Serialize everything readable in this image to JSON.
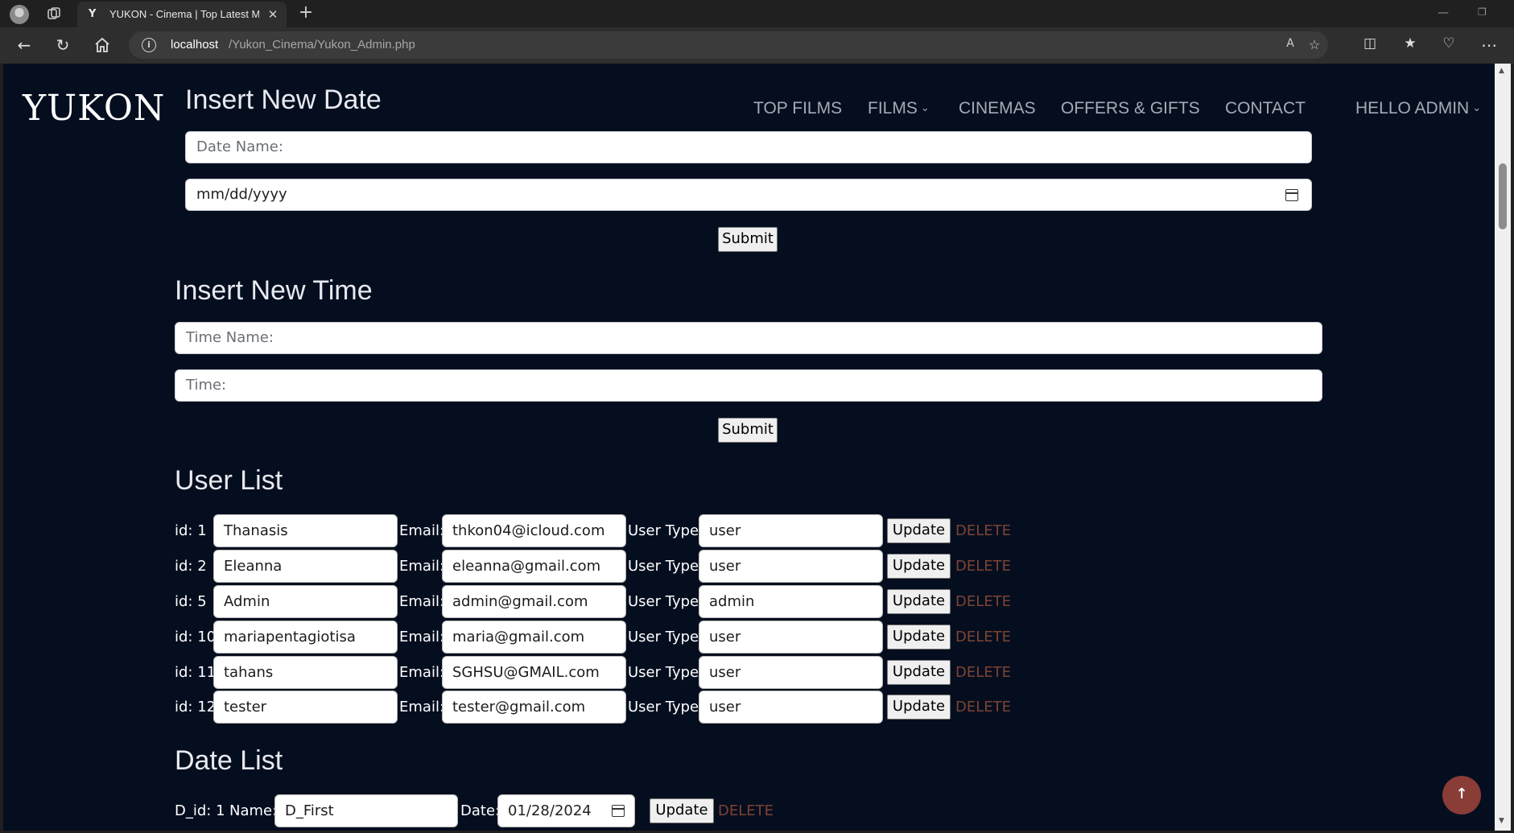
{
  "browser": {
    "tab_title": "YUKON - Cinema | Top Latest Movies",
    "tab_favicon": "Y",
    "url_host": "localhost",
    "url_path": "/Yukon_Cinema/Yukon_Admin.php"
  },
  "site": {
    "logo": "YUKON",
    "nav": {
      "top_films": "TOP FILMS",
      "films": "FILMS",
      "cinemas": "CINEMAS",
      "offers": "OFFERS & GIFTS",
      "contact": "CONTACT",
      "account": "HELLO ADMIN"
    }
  },
  "insert_date": {
    "heading": "Insert New Date",
    "name_placeholder": "Date Name:",
    "date_placeholder": "mm/dd/yyyy",
    "submit": "Submit"
  },
  "insert_time": {
    "heading": "Insert New Time",
    "name_placeholder": "Time Name:",
    "time_placeholder": "Time:",
    "submit": "Submit"
  },
  "user_list": {
    "heading": "User List",
    "email_label": "Email:",
    "type_label": "User Type:",
    "update_label": "Update",
    "delete_label": "DELETE",
    "users": [
      {
        "id": "id: 1",
        "name": "Thanasis",
        "email": "thkon04@icloud.com",
        "type": "user"
      },
      {
        "id": "id: 2",
        "name": "Eleanna",
        "email": "eleanna@gmail.com",
        "type": "user"
      },
      {
        "id": "id: 5",
        "name": "Admin",
        "email": "admin@gmail.com",
        "type": "admin"
      },
      {
        "id": "id: 10",
        "name": "mariapentagiotisa",
        "email": "maria@gmail.com",
        "type": "user"
      },
      {
        "id": "id: 11",
        "name": "tahans",
        "email": "SGHSU@GMAIL.com",
        "type": "user"
      },
      {
        "id": "id: 12",
        "name": "tester",
        "email": "tester@gmail.com",
        "type": "user"
      }
    ]
  },
  "date_list": {
    "heading": "Date List",
    "name_label": "Name:",
    "date_label": "Date:",
    "update_label": "Update",
    "delete_label": "DELETE",
    "rows": [
      {
        "id": "D_id: 1",
        "name": "D_First",
        "date": "01/28/2024"
      }
    ]
  },
  "colors": {
    "page_bg": "#050e1f",
    "delete_link": "#7d4232",
    "to_top_button": "#8a3c37"
  }
}
